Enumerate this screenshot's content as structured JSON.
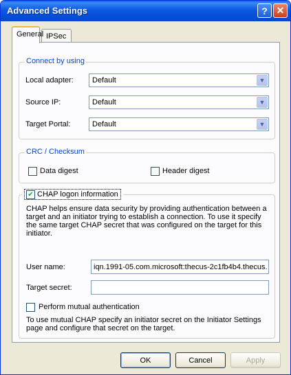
{
  "window": {
    "title": "Advanced Settings",
    "help_glyph": "?",
    "close_glyph": "✕"
  },
  "tabs": [
    {
      "label": "General",
      "active": true
    },
    {
      "label": "IPSec",
      "active": false
    }
  ],
  "connect_group": {
    "legend": "Connect by using",
    "rows": [
      {
        "label": "Local adapter:",
        "value": "Default"
      },
      {
        "label": "Source IP:",
        "value": "Default"
      },
      {
        "label": "Target Portal:",
        "value": "Default"
      }
    ]
  },
  "crc_group": {
    "legend": "CRC / Checksum",
    "data_digest": "Data digest",
    "header_digest": "Header digest"
  },
  "chap_group": {
    "legend": "CHAP logon information",
    "checked_glyph": "✔",
    "description": "CHAP helps ensure data security by providing authentication between a target and an initiator trying to establish a connection. To use it specify the same target CHAP secret that was configured on the target for this initiator.",
    "user_name_label": "User name:",
    "user_name_value": "iqn.1991-05.com.microsoft:thecus-2c1fb4b4.thecus.",
    "target_secret_label": "Target secret:",
    "target_secret_value": "",
    "mutual_label": "Perform mutual authentication",
    "mutual_help": "To use mutual CHAP specify an initiator secret on the Initiator Settings page and configure that secret on the target."
  },
  "buttons": {
    "ok": "OK",
    "cancel": "Cancel",
    "apply": "Apply"
  },
  "colors": {
    "titlebar": "#0b58e3",
    "legend_text": "#0046d5",
    "dialog_bg": "#ece9d8"
  }
}
